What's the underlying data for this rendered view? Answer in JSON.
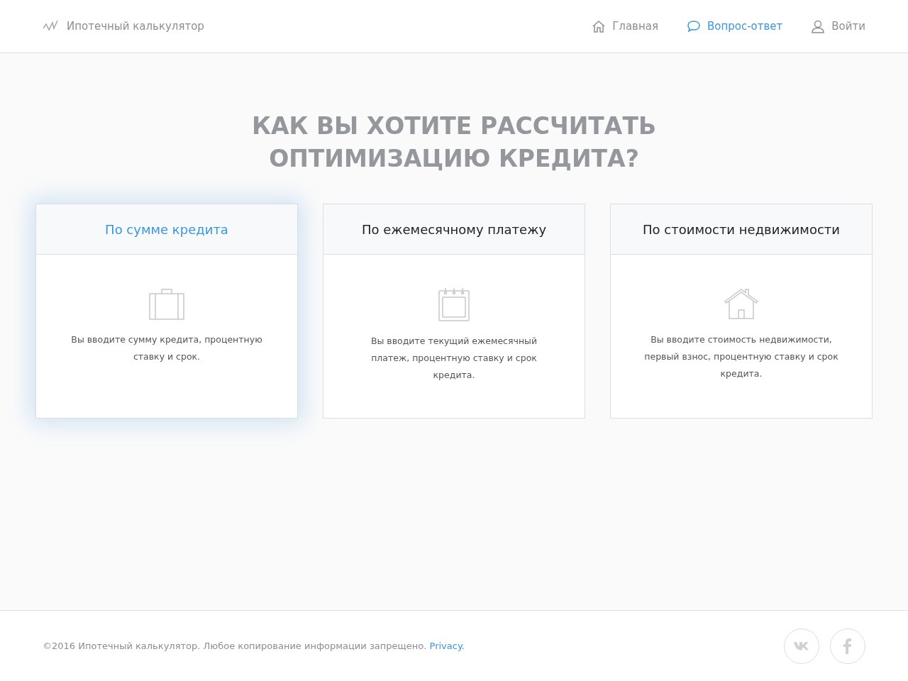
{
  "header": {
    "logo_text": "Ипотечный калькулятор",
    "nav": [
      {
        "kind": "home",
        "label": "Главная",
        "selected": false
      },
      {
        "kind": "chat",
        "label": "Вопрос-ответ",
        "selected": true
      },
      {
        "kind": "user",
        "label": "Войти",
        "selected": false
      }
    ]
  },
  "heading": [
    "КАК ВЫ ХОТИТЕ РАССЧИТАТЬ",
    "ОПТИМИЗАЦИЮ КРЕДИТА?"
  ],
  "cards": [
    {
      "kind": "briefcase",
      "title": "По сумме кредита",
      "description": "Вы вводите сумму кредита, процентную ставку и срок.",
      "selected": true
    },
    {
      "kind": "calendar",
      "title": "По ежемесячному платежу",
      "description": "Вы вводите текущий ежемесячный платеж, процентную ставку и срок кредита.",
      "selected": false
    },
    {
      "kind": "house",
      "title": "По стоимости недвижимости",
      "description": "Вы вводите стоимость недвижимости, первый взнос, процентную ставку и срок кредита.",
      "selected": false
    }
  ],
  "footer": {
    "copyright": "©2016 Ипотечный калькулятор. Любое копирование информации запрещено.",
    "link": "Privacy.",
    "social": [
      {
        "kind": "vk"
      },
      {
        "kind": "facebook"
      }
    ]
  }
}
